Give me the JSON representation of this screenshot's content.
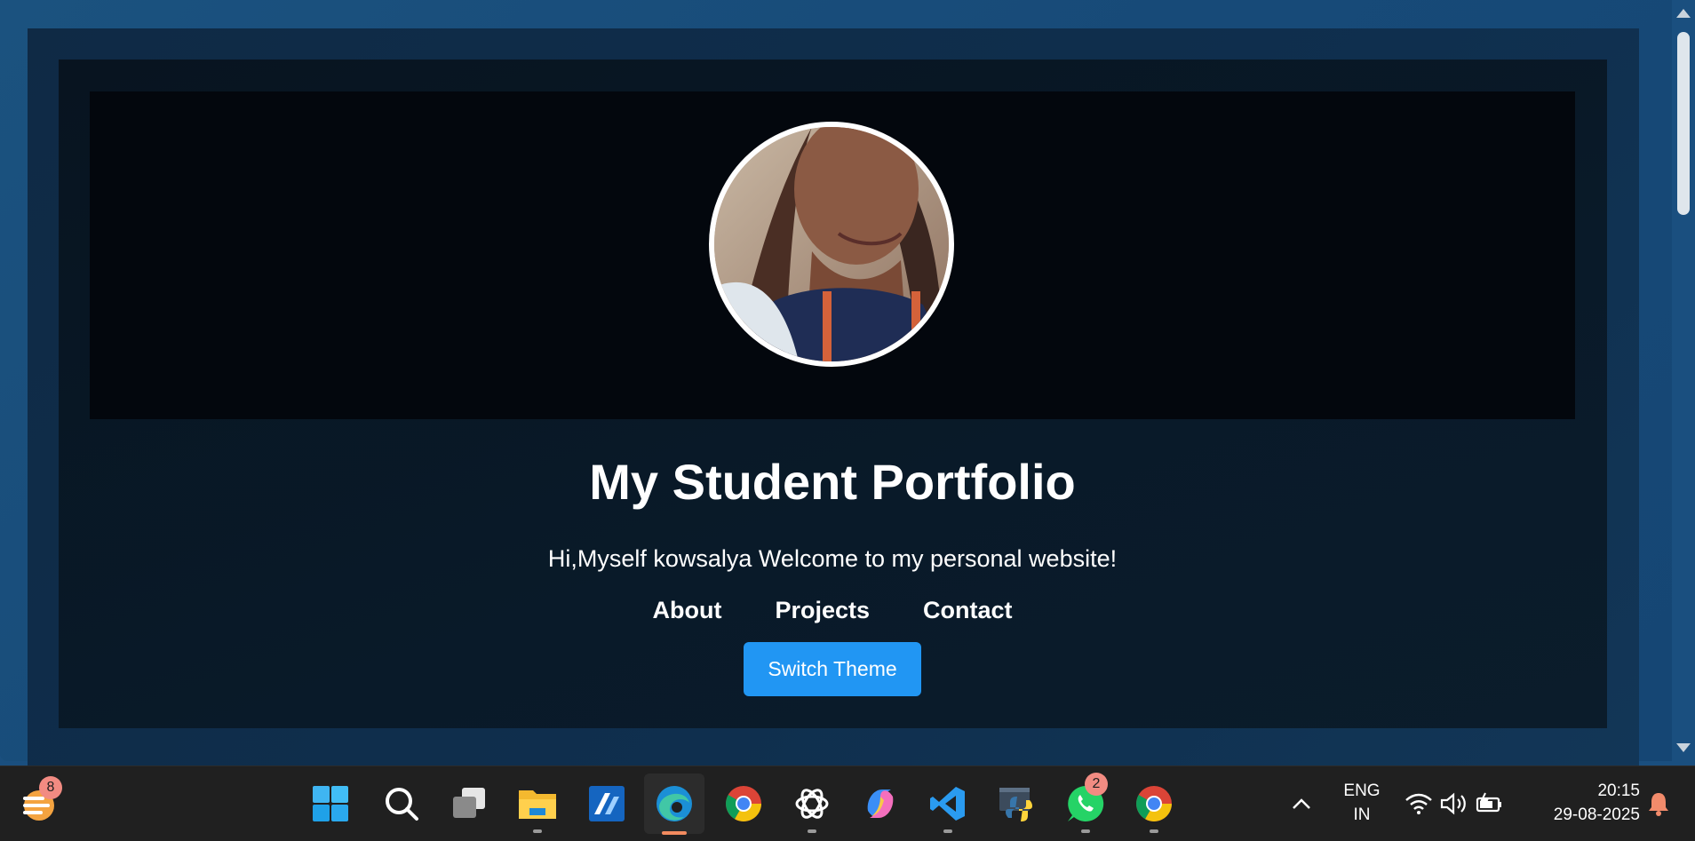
{
  "site": {
    "title": "My Student Portfolio",
    "subtitle": "Hi,Myself kowsalya Welcome to my personal website!",
    "nav": [
      "About",
      "Projects",
      "Contact"
    ],
    "theme_button": "Switch Theme"
  },
  "colors": {
    "page_bg": "#1a4f7f",
    "accent_button": "#2196f3",
    "text": "#ffffff"
  },
  "taskbar": {
    "weather_badge": "8",
    "whatsapp_badge": "2",
    "apps": [
      "start-icon",
      "search-icon",
      "task-view-icon",
      "file-explorer-icon",
      "app-icon",
      "edge-icon",
      "chrome-icon",
      "chatgpt-icon",
      "copilot-icon",
      "vscode-icon",
      "python-icon",
      "whatsapp-icon",
      "chrome-icon"
    ],
    "language_top": "ENG",
    "language_bottom": "IN",
    "time": "20:15",
    "date": "29-08-2025"
  }
}
